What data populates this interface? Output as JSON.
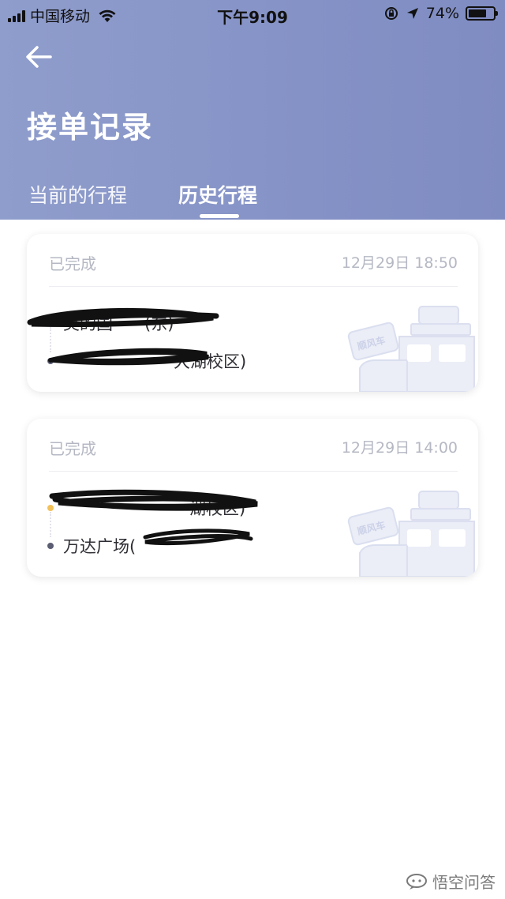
{
  "status_bar": {
    "carrier": "中国移动",
    "time": "下午9:09",
    "battery_percent": "74%",
    "battery_level": 0.74
  },
  "header": {
    "back_icon": "arrow-left-icon",
    "title": "接单记录",
    "tabs": [
      {
        "label": "当前的行程",
        "active": false
      },
      {
        "label": "历史行程",
        "active": true
      }
    ]
  },
  "trips": [
    {
      "status": "已完成",
      "time": "12月29日 18:50",
      "from": "美的国",
      "from_tail": "(东)",
      "to": "",
      "to_tail": "大湖校区)",
      "badge": "顺风车"
    },
    {
      "status": "已完成",
      "time": "12月29日 14:00",
      "from": "",
      "from_tail": "湖校区)",
      "to": "万达广场(",
      "to_tail": "",
      "badge": "顺风车"
    }
  ],
  "watermark": {
    "text": "悟空问答",
    "icon": "chat-bubble-icon"
  },
  "colors": {
    "header_bg": "#8592c6",
    "dot_start": "#f2c15a",
    "dot_end": "#5b5d72",
    "muted_text": "#b5b8c3"
  }
}
